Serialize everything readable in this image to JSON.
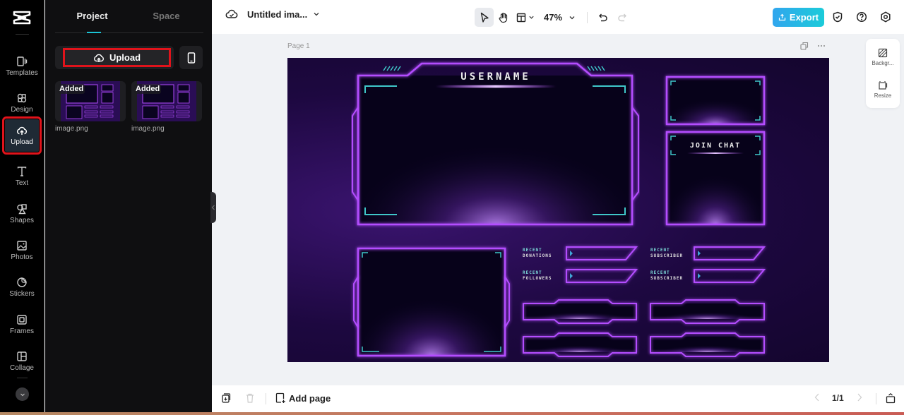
{
  "rail": {
    "items": [
      {
        "label": "Templates",
        "icon": "templates-icon"
      },
      {
        "label": "Design",
        "icon": "design-icon"
      },
      {
        "label": "Upload",
        "icon": "upload-cloud-icon",
        "active": true
      },
      {
        "label": "Text",
        "icon": "text-icon"
      },
      {
        "label": "Shapes",
        "icon": "shapes-icon"
      },
      {
        "label": "Photos",
        "icon": "photos-icon"
      },
      {
        "label": "Stickers",
        "icon": "stickers-icon"
      },
      {
        "label": "Frames",
        "icon": "frames-icon"
      },
      {
        "label": "Collage",
        "icon": "collage-icon"
      }
    ]
  },
  "panel": {
    "tabs": [
      {
        "label": "Project",
        "active": true
      },
      {
        "label": "Space",
        "active": false
      }
    ],
    "upload_label": "Upload",
    "files": [
      {
        "badge": "Added",
        "name": "image.png"
      },
      {
        "badge": "Added",
        "name": "image.png"
      }
    ]
  },
  "topbar": {
    "title": "Untitled ima...",
    "zoom": "47%",
    "export_label": "Export"
  },
  "canvas": {
    "page_label": "Page 1",
    "overlay": {
      "username": "USERNAME",
      "join_chat": "JOIN CHAT",
      "labels": [
        {
          "line1": "RECENT",
          "line2": "DONATIONS"
        },
        {
          "line1": "RECENT",
          "line2": "SUBSCRIBER"
        },
        {
          "line1": "RECENT",
          "line2": "FOLLOWERS"
        },
        {
          "line1": "RECENT",
          "line2": "SUBSCRIBER"
        }
      ]
    }
  },
  "side_tools": [
    {
      "label": "Backgr...",
      "icon": "background-icon"
    },
    {
      "label": "Resize",
      "icon": "resize-icon"
    }
  ],
  "bottombar": {
    "add_page_label": "Add page",
    "page_count": "1/1"
  },
  "colors": {
    "accent": "#1bc4d6",
    "export_gradient_start": "#31a6ee",
    "export_gradient_end": "#1bcbd9",
    "highlight_red": "#e0131b",
    "neon_purple": "#b44dff",
    "neon_teal": "#3fc7c9"
  }
}
